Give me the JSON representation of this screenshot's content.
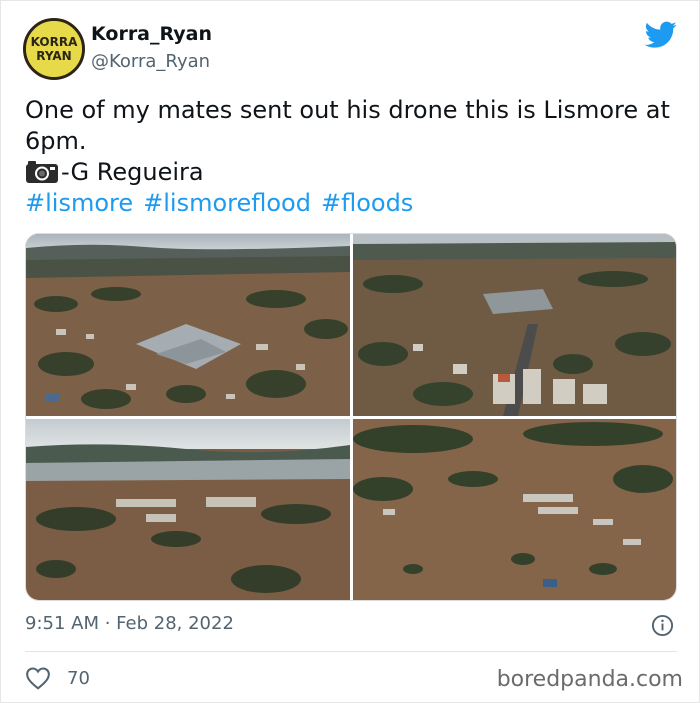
{
  "user": {
    "display_name": "Korra_Ryan",
    "handle": "@Korra_Ryan",
    "avatar_text": "KORRA RYAN"
  },
  "tweet": {
    "text_line1": "One of my mates sent out his drone this is Lismore at 6pm.",
    "credit": "-G Regueira",
    "credit_icon": "camera-icon",
    "hashtags": [
      "#lismore",
      "#lismoreflood",
      "#floods"
    ],
    "timestamp": "9:51 AM · Feb 28, 2022",
    "likes": "70"
  },
  "icons": {
    "brand": "twitter-bird-icon",
    "info": "info-icon",
    "like": "heart-icon"
  },
  "colors": {
    "link": "#1d9bf0",
    "muted": "#536471",
    "brand": "#1d9bf0"
  },
  "watermark": "boredpanda.com"
}
